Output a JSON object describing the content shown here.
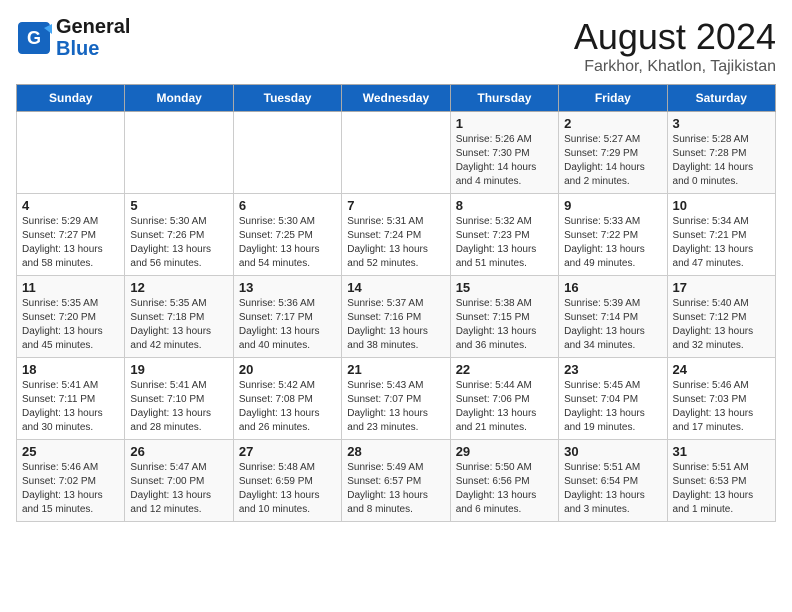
{
  "header": {
    "logo_line1": "General",
    "logo_line2": "Blue",
    "month": "August 2024",
    "location": "Farkhor, Khatlon, Tajikistan"
  },
  "days_of_week": [
    "Sunday",
    "Monday",
    "Tuesday",
    "Wednesday",
    "Thursday",
    "Friday",
    "Saturday"
  ],
  "weeks": [
    [
      {
        "day": "",
        "info": ""
      },
      {
        "day": "",
        "info": ""
      },
      {
        "day": "",
        "info": ""
      },
      {
        "day": "",
        "info": ""
      },
      {
        "day": "1",
        "info": "Sunrise: 5:26 AM\nSunset: 7:30 PM\nDaylight: 14 hours\nand 4 minutes."
      },
      {
        "day": "2",
        "info": "Sunrise: 5:27 AM\nSunset: 7:29 PM\nDaylight: 14 hours\nand 2 minutes."
      },
      {
        "day": "3",
        "info": "Sunrise: 5:28 AM\nSunset: 7:28 PM\nDaylight: 14 hours\nand 0 minutes."
      }
    ],
    [
      {
        "day": "4",
        "info": "Sunrise: 5:29 AM\nSunset: 7:27 PM\nDaylight: 13 hours\nand 58 minutes."
      },
      {
        "day": "5",
        "info": "Sunrise: 5:30 AM\nSunset: 7:26 PM\nDaylight: 13 hours\nand 56 minutes."
      },
      {
        "day": "6",
        "info": "Sunrise: 5:30 AM\nSunset: 7:25 PM\nDaylight: 13 hours\nand 54 minutes."
      },
      {
        "day": "7",
        "info": "Sunrise: 5:31 AM\nSunset: 7:24 PM\nDaylight: 13 hours\nand 52 minutes."
      },
      {
        "day": "8",
        "info": "Sunrise: 5:32 AM\nSunset: 7:23 PM\nDaylight: 13 hours\nand 51 minutes."
      },
      {
        "day": "9",
        "info": "Sunrise: 5:33 AM\nSunset: 7:22 PM\nDaylight: 13 hours\nand 49 minutes."
      },
      {
        "day": "10",
        "info": "Sunrise: 5:34 AM\nSunset: 7:21 PM\nDaylight: 13 hours\nand 47 minutes."
      }
    ],
    [
      {
        "day": "11",
        "info": "Sunrise: 5:35 AM\nSunset: 7:20 PM\nDaylight: 13 hours\nand 45 minutes."
      },
      {
        "day": "12",
        "info": "Sunrise: 5:35 AM\nSunset: 7:18 PM\nDaylight: 13 hours\nand 42 minutes."
      },
      {
        "day": "13",
        "info": "Sunrise: 5:36 AM\nSunset: 7:17 PM\nDaylight: 13 hours\nand 40 minutes."
      },
      {
        "day": "14",
        "info": "Sunrise: 5:37 AM\nSunset: 7:16 PM\nDaylight: 13 hours\nand 38 minutes."
      },
      {
        "day": "15",
        "info": "Sunrise: 5:38 AM\nSunset: 7:15 PM\nDaylight: 13 hours\nand 36 minutes."
      },
      {
        "day": "16",
        "info": "Sunrise: 5:39 AM\nSunset: 7:14 PM\nDaylight: 13 hours\nand 34 minutes."
      },
      {
        "day": "17",
        "info": "Sunrise: 5:40 AM\nSunset: 7:12 PM\nDaylight: 13 hours\nand 32 minutes."
      }
    ],
    [
      {
        "day": "18",
        "info": "Sunrise: 5:41 AM\nSunset: 7:11 PM\nDaylight: 13 hours\nand 30 minutes."
      },
      {
        "day": "19",
        "info": "Sunrise: 5:41 AM\nSunset: 7:10 PM\nDaylight: 13 hours\nand 28 minutes."
      },
      {
        "day": "20",
        "info": "Sunrise: 5:42 AM\nSunset: 7:08 PM\nDaylight: 13 hours\nand 26 minutes."
      },
      {
        "day": "21",
        "info": "Sunrise: 5:43 AM\nSunset: 7:07 PM\nDaylight: 13 hours\nand 23 minutes."
      },
      {
        "day": "22",
        "info": "Sunrise: 5:44 AM\nSunset: 7:06 PM\nDaylight: 13 hours\nand 21 minutes."
      },
      {
        "day": "23",
        "info": "Sunrise: 5:45 AM\nSunset: 7:04 PM\nDaylight: 13 hours\nand 19 minutes."
      },
      {
        "day": "24",
        "info": "Sunrise: 5:46 AM\nSunset: 7:03 PM\nDaylight: 13 hours\nand 17 minutes."
      }
    ],
    [
      {
        "day": "25",
        "info": "Sunrise: 5:46 AM\nSunset: 7:02 PM\nDaylight: 13 hours\nand 15 minutes."
      },
      {
        "day": "26",
        "info": "Sunrise: 5:47 AM\nSunset: 7:00 PM\nDaylight: 13 hours\nand 12 minutes."
      },
      {
        "day": "27",
        "info": "Sunrise: 5:48 AM\nSunset: 6:59 PM\nDaylight: 13 hours\nand 10 minutes."
      },
      {
        "day": "28",
        "info": "Sunrise: 5:49 AM\nSunset: 6:57 PM\nDaylight: 13 hours\nand 8 minutes."
      },
      {
        "day": "29",
        "info": "Sunrise: 5:50 AM\nSunset: 6:56 PM\nDaylight: 13 hours\nand 6 minutes."
      },
      {
        "day": "30",
        "info": "Sunrise: 5:51 AM\nSunset: 6:54 PM\nDaylight: 13 hours\nand 3 minutes."
      },
      {
        "day": "31",
        "info": "Sunrise: 5:51 AM\nSunset: 6:53 PM\nDaylight: 13 hours\nand 1 minute."
      }
    ]
  ]
}
